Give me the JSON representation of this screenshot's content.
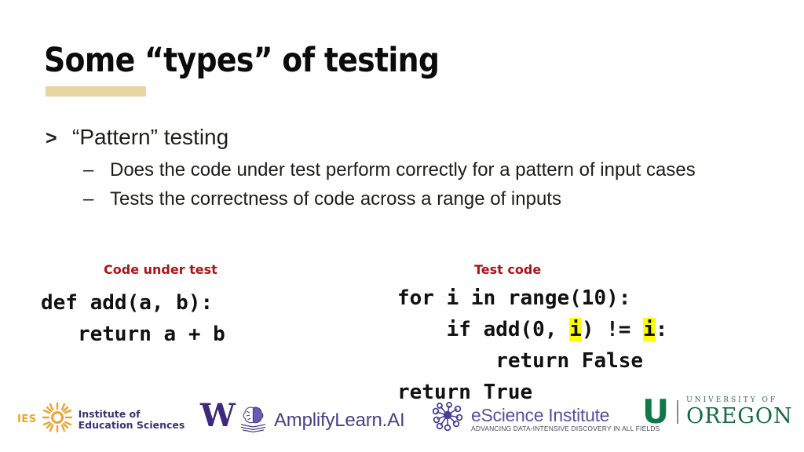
{
  "slide": {
    "title": "Some “types” of testing",
    "accent_bar_color": "#e8d5a2",
    "background_color": "#ffffff"
  },
  "bullets": {
    "level1": {
      "marker": ">",
      "text": "“Pattern” testing"
    },
    "level2": [
      {
        "marker": "–",
        "text": "Does the code under test perform correctly for a pattern of input cases"
      },
      {
        "marker": "–",
        "text": "Tests the correctness of code across a range of inputs"
      }
    ]
  },
  "code_section": {
    "label_color": "#ae1313",
    "highlight_color": "#ffff00",
    "left": {
      "label": "Code under test",
      "lines": [
        "def add(a, b):",
        "   return a + b"
      ]
    },
    "right": {
      "label": "Test code",
      "line1": "for i in range(10):",
      "line2_a": "    if add(0, ",
      "line2_hl1": "i",
      "line2_b": ") != ",
      "line2_hl2": "i",
      "line2_c": ":",
      "line3": "        return False",
      "line4": "return True"
    }
  },
  "footer": {
    "logos": [
      {
        "name": "ies",
        "mark": "IES",
        "line1": "Institute of",
        "line2": "Education Sciences",
        "mark_color": "#f0a32a",
        "text_color": "#3d3177"
      },
      {
        "name": "university-of-washington",
        "mark": "W",
        "color": "#3b2a7a"
      },
      {
        "name": "amplifylearn-ai",
        "text": "AmplifyLearn.AI",
        "color": "#4b3f86"
      },
      {
        "name": "escience-institute",
        "title": "eScience Institute",
        "tagline": "ADVANCING DATA-INTENSIVE DISCOVERY IN ALL FIELDS",
        "color": "#5b4fa0"
      },
      {
        "name": "university-of-oregon",
        "mark": "U",
        "line_small": "UNIVERSITY OF",
        "line_large": "OREGON",
        "color": "#146b3f"
      }
    ]
  }
}
